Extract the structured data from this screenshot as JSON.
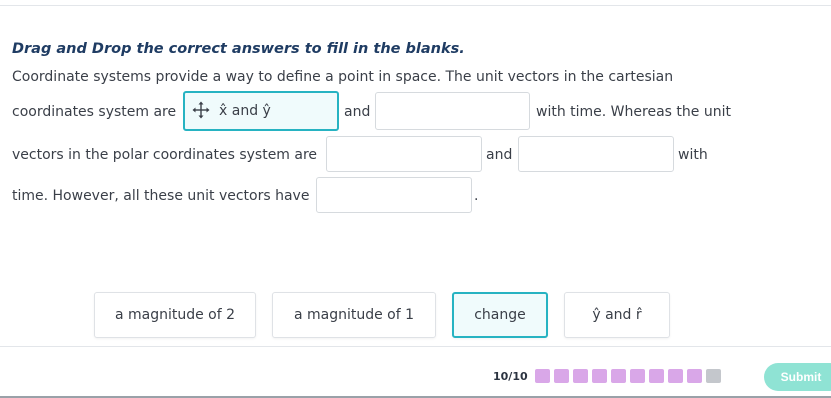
{
  "instruction": "Drag and Drop the correct answers to fill in the blanks.",
  "passage": {
    "line1": "Coordinate systems provide a way to define a point in space. The unit vectors in the cartesian",
    "line2_a": "coordinates system are",
    "blank1_text": "x̂ and ŷ",
    "line2_b": "and",
    "line2_c": "with time. Whereas the unit",
    "line3_a": "vectors in the polar coordinates system are",
    "line3_b": "and",
    "line3_c": "with",
    "line4_a": "time. However, all these unit vectors have",
    "line4_b": "."
  },
  "choices": [
    {
      "label": "a magnitude of 2"
    },
    {
      "label": "a magnitude of 1"
    },
    {
      "label": "change"
    },
    {
      "label": "ŷ and r̂"
    }
  ],
  "progress": {
    "label": "10/10",
    "total_dots": 10,
    "filled_dots": 9
  },
  "submit_label": "Submit",
  "colors": {
    "accent": "#27b3c2",
    "title": "#1f3c63",
    "dot": "#d9a7e8",
    "submit": "#8fe3d4"
  }
}
